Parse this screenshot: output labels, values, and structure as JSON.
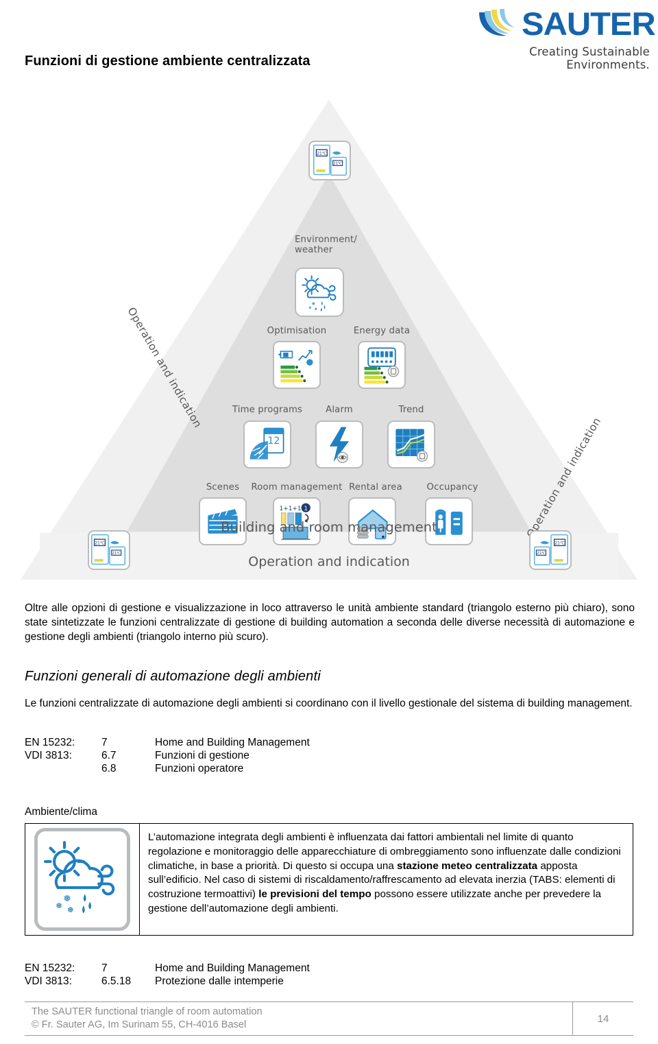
{
  "brand": {
    "logo_wordmark": "SAUTER",
    "logo_tagline": "Creating Sustainable Environments.",
    "logo_blue": "#1664ab",
    "logo_light_blue": "#8cc8e8",
    "logo_yellow": "#f2d64b",
    "icon_blue": "#1f7fc0"
  },
  "page_title": "Funzioni di gestione ambiente centralizzata",
  "diagram": {
    "left_edge_label": "Operation and indication",
    "right_edge_label": "Operation and indication",
    "inner_base_caption": "Building and room management",
    "outer_base_caption": "Operation and indication",
    "room_unit_display": "21°C",
    "tiles": [
      {
        "label": "Environment/\nweather",
        "icon": "weather-icon"
      },
      {
        "label": "Optimisation",
        "icon": "optimisation-icon"
      },
      {
        "label": "Energy data",
        "icon": "energy-data-icon"
      },
      {
        "label": "Time programs",
        "icon": "time-programs-icon"
      },
      {
        "label": "Alarm",
        "icon": "alarm-icon"
      },
      {
        "label": "Trend",
        "icon": "trend-icon"
      },
      {
        "label": "Scenes",
        "icon": "scenes-icon"
      },
      {
        "label": "Room management",
        "icon": "room-management-icon"
      },
      {
        "label": "Rental area",
        "icon": "rental-area-icon"
      },
      {
        "label": "Occupancy",
        "icon": "occupancy-icon"
      }
    ],
    "tile_labels": {
      "environment_weather_l1": "Environment/",
      "environment_weather_l2": "weather",
      "optimisation": "Optimisation",
      "energy_data": "Energy data",
      "time_programs": "Time programs",
      "alarm": "Alarm",
      "trend": "Trend",
      "scenes": "Scenes",
      "room_management": "Room management",
      "rental_area": "Rental area",
      "occupancy": "Occupancy"
    },
    "time_programs_number": "12",
    "room_management_formula": "1+1+1="
  },
  "intro_paragraph": "Oltre alle opzioni di gestione e visualizzazione in loco attraverso le unità ambiente standard (triangolo esterno più chiaro), sono state sintetizzate le funzioni centralizzate di gestione di building automation a seconda delle diverse necessità di automazione e gestione degli ambienti (triangolo interno più scuro).",
  "section_heading": "Funzioni generali di automazione degli ambienti",
  "general_paragraph": "Le funzioni centralizzate di automazione degli ambienti si coordinano con il livello gestionale del sistema di building management.",
  "references_top": [
    {
      "standard": "EN 15232:",
      "clause": "7",
      "title": "Home and Building Management"
    },
    {
      "standard": "VDI 3813:",
      "clause": "6.7",
      "title": "Funzioni di gestione"
    },
    {
      "standard": "",
      "clause": "6.8",
      "title": "Funzioni operatore"
    }
  ],
  "climate_section": {
    "heading": "Ambiente/clima",
    "icon": "weather-icon",
    "text_part1": "L’automazione integrata degli ambienti è influenzata dai fattori ambientali nel limite di quanto regolazione e monitoraggio delle apparecchiature di ombreggiamento sono influenzate dalle condizioni climatiche, in base a priorità. Di questo si occupa una ",
    "bold1": "stazione meteo centralizzata",
    "text_part2": " apposta sull’edificio. Nel caso di sistemi di riscaldamento/raffrescamento ad elevata inerzia (TABS: elementi di costruzione termoattivi) ",
    "bold2": "le previsioni del tempo",
    "text_part3": " possono essere utilizzate anche per prevedere la gestione dell’automazione degli ambienti."
  },
  "references_bottom": [
    {
      "standard": "EN 15232:",
      "clause": "7",
      "title": "Home and Building Management"
    },
    {
      "standard": "VDI 3813:",
      "clause": "6.5.18",
      "title": "Protezione dalle intemperie"
    }
  ],
  "footer": {
    "line1": "The SAUTER functional triangle of room automation",
    "line2": "© Fr. Sauter AG, Im Surinam 55, CH-4016 Basel",
    "page_number": "14"
  }
}
